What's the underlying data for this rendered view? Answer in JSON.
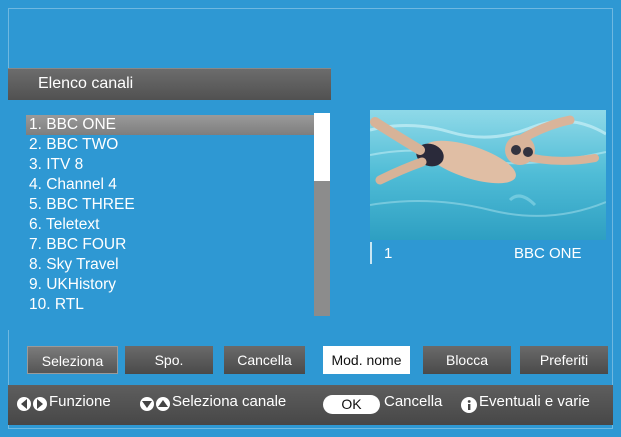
{
  "header": {
    "title": "Elenco canali"
  },
  "channels": [
    "1. BBC ONE",
    "2. BBC TWO",
    "3. ITV 8",
    "4. Channel 4",
    "5. BBC THREE",
    "6. Teletext",
    "7. BBC FOUR",
    "8. Sky Travel",
    "9. UKHistory",
    "10. RTL"
  ],
  "selected_index": 0,
  "preview": {
    "number": "1",
    "name": "BBC ONE"
  },
  "buttons": {
    "seleziona": "Seleziona",
    "spo": "Spo.",
    "cancella": "Cancella",
    "mod_nome": "Mod. nome",
    "blocca": "Blocca",
    "preferiti": "Preferiti"
  },
  "help": {
    "funzione": "Funzione",
    "seleziona_canale": "Seleziona canale",
    "ok": "OK",
    "cancella": "Cancella",
    "eventuali": "Eventuali e varie"
  },
  "icons": {
    "left_right": "left-right-arrows-icon",
    "up_down": "up-down-arrows-icon",
    "info": "info-icon"
  },
  "colors": {
    "background": "#2e98d3",
    "bar": "#555555",
    "selected": "#8e8e8e"
  }
}
